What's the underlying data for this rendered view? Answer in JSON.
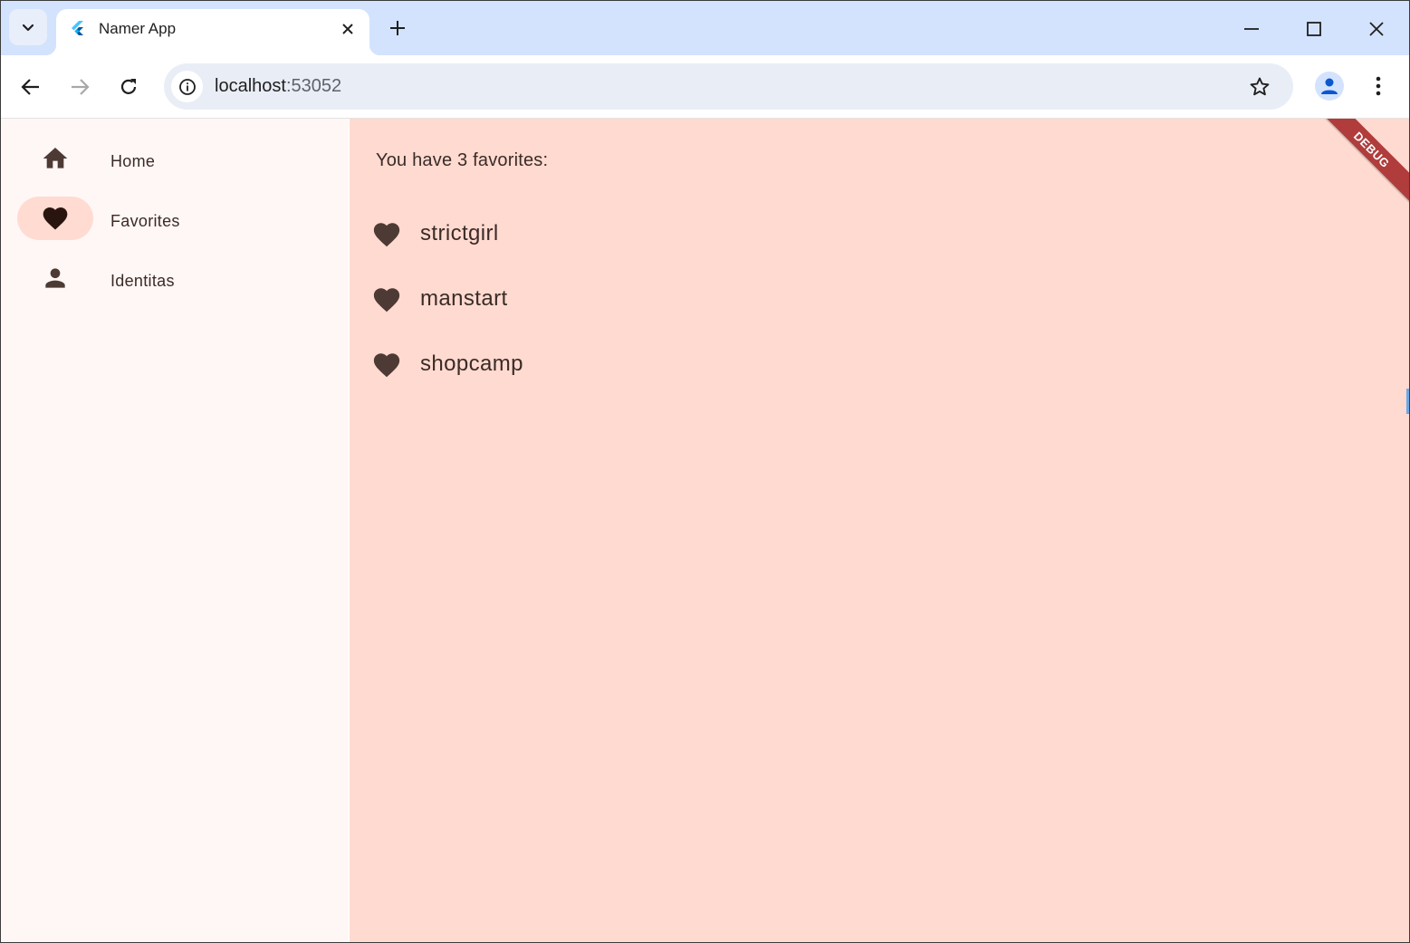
{
  "browser": {
    "tab": {
      "title": "Namer App"
    },
    "address_bar": {
      "host": "localhost",
      "port": ":53052"
    }
  },
  "app": {
    "navigation": [
      {
        "label": "Home",
        "icon": "home-icon",
        "selected": false
      },
      {
        "label": "Favorites",
        "icon": "heart-icon",
        "selected": true
      },
      {
        "label": "Identitas",
        "icon": "person-icon",
        "selected": false
      }
    ],
    "favorites": {
      "heading": "You have 3 favorites:",
      "items": [
        "strictgirl",
        "manstart",
        "shopcamp"
      ]
    },
    "debug_banner": "DEBUG"
  },
  "colors": {
    "tabstrip": "#d3e3fd",
    "nav_background": "#fff7f5",
    "content_background": "#ffdad0",
    "nav_indicator": "#ffdbd1",
    "icon": "#4e3a35",
    "debug_ribbon": "#b03c3c"
  }
}
